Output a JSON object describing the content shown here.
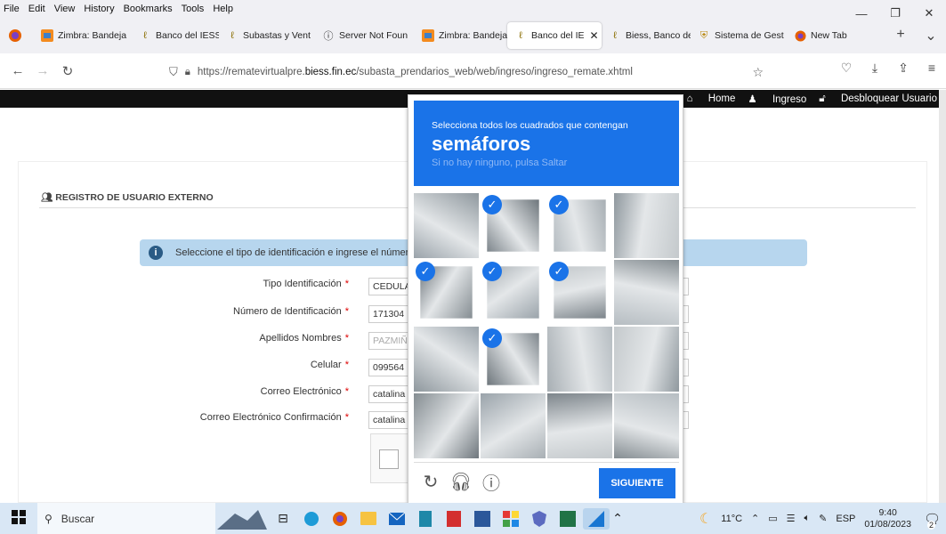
{
  "menu": [
    "File",
    "Edit",
    "View",
    "History",
    "Bookmarks",
    "Tools",
    "Help"
  ],
  "tabs": [
    {
      "label": "Zimbra: Bandeja",
      "icon": "zimbra-icon",
      "active": false
    },
    {
      "label": "Banco del IESS",
      "icon": "biess-icon",
      "active": false
    },
    {
      "label": "Subastas y Vent",
      "icon": "biess-icon",
      "active": false
    },
    {
      "label": "Server Not Foun",
      "icon": "info-icon",
      "active": false
    },
    {
      "label": "Zimbra: Bandeja",
      "icon": "zimbra-icon",
      "active": false
    },
    {
      "label": "Banco del IE",
      "icon": "biess-icon",
      "active": true
    },
    {
      "label": "Biess, Banco del",
      "icon": "biess-icon",
      "active": false
    },
    {
      "label": "Sistema de Gest",
      "icon": "shield-icon",
      "active": false
    },
    {
      "label": "New Tab",
      "icon": "firefox-icon",
      "active": false
    }
  ],
  "url": {
    "prefix": "https://rematevirtualpre.",
    "domain": "biess.fin.ec",
    "path": "/subasta_prendarios_web/web/ingreso/ingreso_remate.xhtml"
  },
  "sitenav": {
    "home": "Home",
    "ingreso": "Ingreso",
    "desbloquear": "Desbloquear Usuario"
  },
  "page": {
    "section_title": "REGISTRO DE USUARIO EXTERNO",
    "alert": "Seleccione el tipo de identificación e ingrese el número",
    "required_mark": "*",
    "fields": [
      {
        "label": "Tipo Identificación",
        "value": "CEDULA"
      },
      {
        "label": "Número de Identificación",
        "value": "171304"
      },
      {
        "label": "Apellidos Nombres",
        "value": "PAZMIÑ"
      },
      {
        "label": "Celular",
        "value": "099564"
      },
      {
        "label": "Correo Electrónico",
        "value": "catalina"
      },
      {
        "label": "Correo Electrónico Confirmación",
        "value": "catalina"
      }
    ]
  },
  "captcha": {
    "instruction": "Selecciona todos los cuadrados que contengan",
    "target": "semáforos",
    "hint": "Si no hay ninguno, pulsa Saltar",
    "next_label": "SIGUIENTE",
    "selected_cells": [
      1,
      2,
      4,
      5,
      6,
      9
    ]
  },
  "taskbar": {
    "search_placeholder": "Buscar",
    "weather": "11°C",
    "lang": "ESP",
    "time": "9:40",
    "date": "01/08/2023",
    "notifications": "2"
  }
}
